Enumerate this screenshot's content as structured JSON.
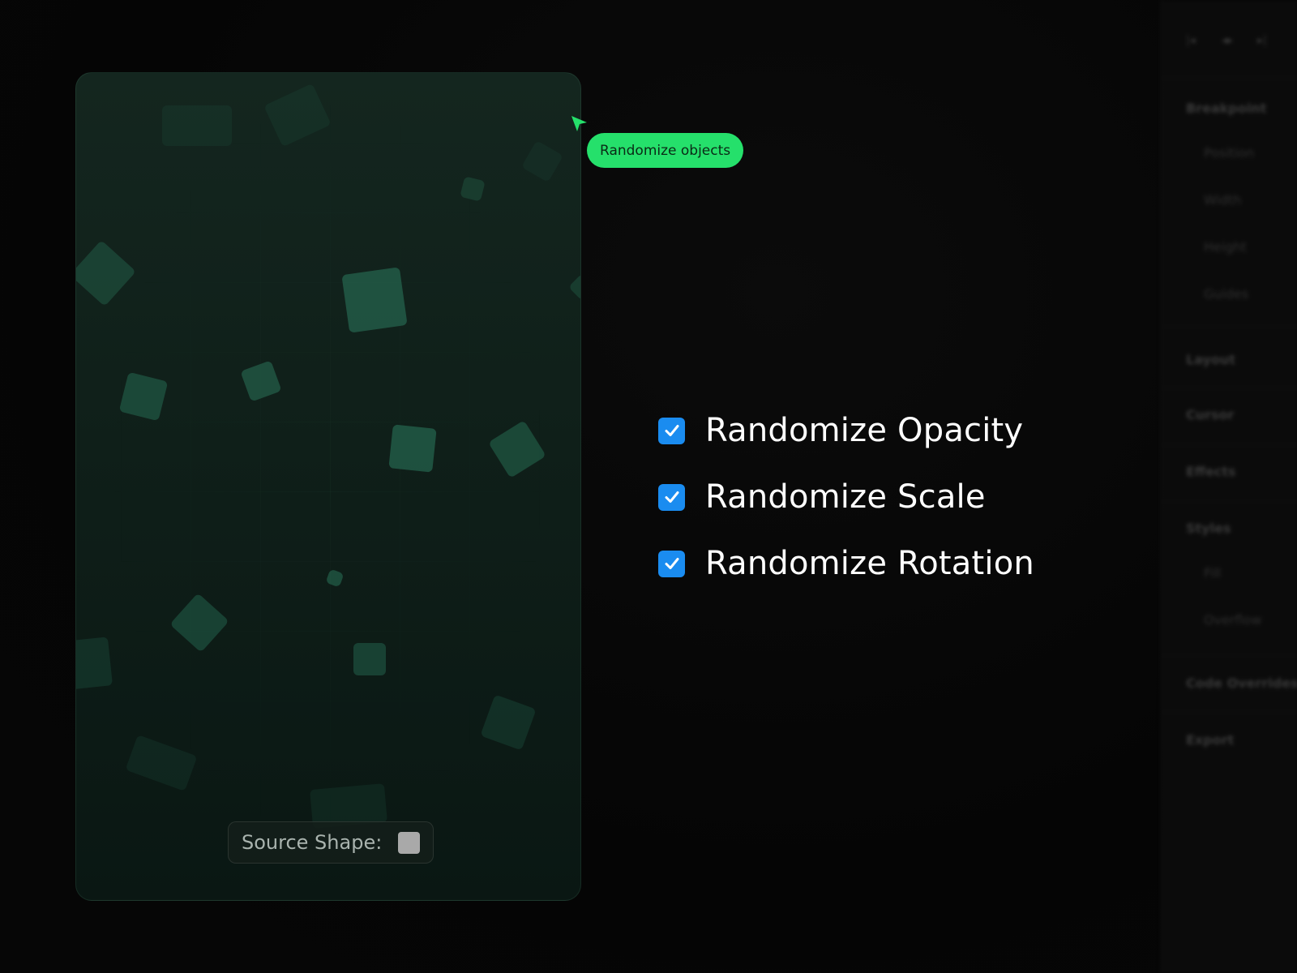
{
  "tooltip": {
    "label": "Randomize objects"
  },
  "canvas": {
    "source_shape_label": "Source Shape:"
  },
  "options": [
    {
      "label": "Randomize Opacity",
      "checked": true
    },
    {
      "label": "Randomize Scale",
      "checked": true
    },
    {
      "label": "Randomize Rotation",
      "checked": true
    }
  ],
  "panel": {
    "breakpoint": "Breakpoint",
    "position": "Position",
    "width": "Width",
    "height": "Height",
    "guides": "Guides",
    "layout": "Layout",
    "cursor": "Cursor",
    "effects": "Effects",
    "styles": "Styles",
    "fill": "Fill",
    "overflow": "Overflow",
    "code_overrides": "Code Overrides",
    "export": "Export"
  },
  "colors": {
    "accent_green": "#25e06b",
    "checkbox_blue": "#1a8cf0",
    "shape_green": "#2b7a5e",
    "source_swatch": "#a9a9a9"
  }
}
